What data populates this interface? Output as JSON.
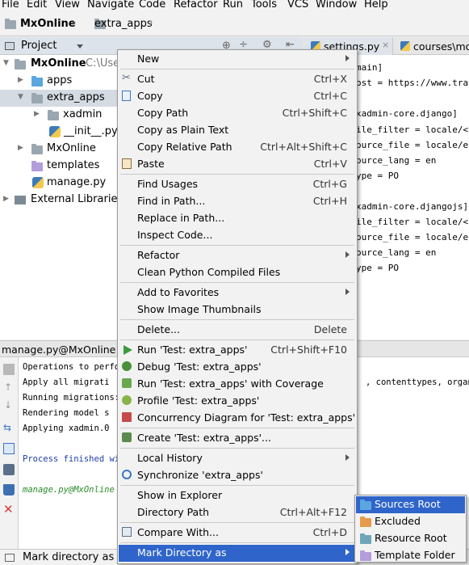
{
  "menubar": [
    "File",
    "Edit",
    "View",
    "Navigate",
    "Code",
    "Refactor",
    "Run",
    "Tools",
    "VCS",
    "Window",
    "Help"
  ],
  "breadcrumb": {
    "project": "MxOnline",
    "folder": "extra_apps"
  },
  "project_panel": {
    "title": "Project"
  },
  "tree": {
    "root_name": "MxOnline",
    "root_path": "C:\\Use",
    "items": [
      "apps",
      "extra_apps",
      "xadmin",
      "__init__.py",
      "MxOnline",
      "templates",
      "manage.py",
      "External Libraries"
    ]
  },
  "editor": {
    "tabs": [
      "settings.py",
      "courses\\mo"
    ],
    "lines": [
      "main]",
      "ost = https://www.trans",
      "",
      "xadmin-core.django]",
      "ile_filter = locale/<la",
      "ource_file = locale/en/",
      "ource_lang = en",
      "ype = PO",
      "",
      "xadmin-core.djangojs]",
      "ile_filter = locale/<la",
      "ource_file = locale/en/",
      "ource_lang = en",
      "ype = PO"
    ]
  },
  "run_panel": {
    "title": "manage.py@MxOnline",
    "lines": [
      "Operations to perfo",
      "  Apply all migrati",
      "Running migrations:",
      "  Rendering model s",
      "  Applying xadmin.0",
      "",
      "Process finished wi",
      "",
      "manage.py@MxOnline"
    ],
    "right_fragment": ", contenttypes, organiz"
  },
  "statusbar": {
    "text": "Mark directory as a"
  },
  "context_menu": [
    {
      "label": "New",
      "shortcut": "",
      "submenu": true,
      "icon": ""
    },
    {
      "sep": true
    },
    {
      "label": "Cut",
      "shortcut": "Ctrl+X",
      "icon": "scissors-icon"
    },
    {
      "label": "Copy",
      "shortcut": "Ctrl+C",
      "icon": "copy-icon"
    },
    {
      "label": "Copy Path",
      "shortcut": "Ctrl+Shift+C",
      "icon": ""
    },
    {
      "label": "Copy as Plain Text",
      "shortcut": "",
      "icon": ""
    },
    {
      "label": "Copy Relative Path",
      "shortcut": "Ctrl+Alt+Shift+C",
      "icon": ""
    },
    {
      "label": "Paste",
      "shortcut": "Ctrl+V",
      "icon": "paste-icon"
    },
    {
      "sep": true
    },
    {
      "label": "Find Usages",
      "shortcut": "Ctrl+G",
      "icon": ""
    },
    {
      "label": "Find in Path...",
      "shortcut": "Ctrl+H",
      "icon": ""
    },
    {
      "label": "Replace in Path...",
      "shortcut": "",
      "icon": ""
    },
    {
      "label": "Inspect Code...",
      "shortcut": "",
      "icon": ""
    },
    {
      "sep": true
    },
    {
      "label": "Refactor",
      "shortcut": "",
      "submenu": true,
      "icon": ""
    },
    {
      "label": "Clean Python Compiled Files",
      "shortcut": "",
      "icon": ""
    },
    {
      "sep": true
    },
    {
      "label": "Add to Favorites",
      "shortcut": "",
      "submenu": true,
      "icon": ""
    },
    {
      "label": "Show Image Thumbnails",
      "shortcut": "",
      "icon": ""
    },
    {
      "sep": true
    },
    {
      "label": "Delete...",
      "shortcut": "Delete",
      "icon": ""
    },
    {
      "sep": true
    },
    {
      "label": "Run 'Test: extra_apps'",
      "shortcut": "Ctrl+Shift+F10",
      "icon": "run-icon"
    },
    {
      "label": "Debug 'Test: extra_apps'",
      "shortcut": "",
      "icon": "debug-icon"
    },
    {
      "label": "Run 'Test: extra_apps' with Coverage",
      "shortcut": "",
      "icon": "coverage-icon"
    },
    {
      "label": "Profile 'Test: extra_apps'",
      "shortcut": "",
      "icon": "profile-icon"
    },
    {
      "label": "Concurrency Diagram for  'Test: extra_apps'",
      "shortcut": "",
      "icon": "concurrency-icon"
    },
    {
      "sep": true
    },
    {
      "label": "Create 'Test: extra_apps'...",
      "shortcut": "",
      "icon": "create-test-icon"
    },
    {
      "sep": true
    },
    {
      "label": "Local History",
      "shortcut": "",
      "submenu": true,
      "icon": ""
    },
    {
      "label": "Synchronize 'extra_apps'",
      "shortcut": "",
      "icon": "sync-icon"
    },
    {
      "sep": true
    },
    {
      "label": "Show in Explorer",
      "shortcut": "",
      "icon": ""
    },
    {
      "label": "Directory Path",
      "shortcut": "Ctrl+Alt+F12",
      "icon": ""
    },
    {
      "sep": true
    },
    {
      "label": "Compare With...",
      "shortcut": "Ctrl+D",
      "icon": "compare-icon"
    },
    {
      "sep": true
    },
    {
      "label": "Mark Directory as",
      "shortcut": "",
      "submenu": true,
      "highlighted": true,
      "icon": ""
    }
  ],
  "submenu": [
    {
      "label": "Sources Root",
      "icon": "sources-root-folder-icon",
      "color": "#5aa6de",
      "highlighted": true
    },
    {
      "label": "Excluded",
      "icon": "excluded-folder-icon",
      "color": "#e59b4b"
    },
    {
      "label": "Resource Root",
      "icon": "resource-root-folder-icon",
      "color": "#6fa5b8"
    },
    {
      "label": "Template Folder",
      "icon": "template-folder-icon",
      "color": "#b39ddb"
    }
  ]
}
